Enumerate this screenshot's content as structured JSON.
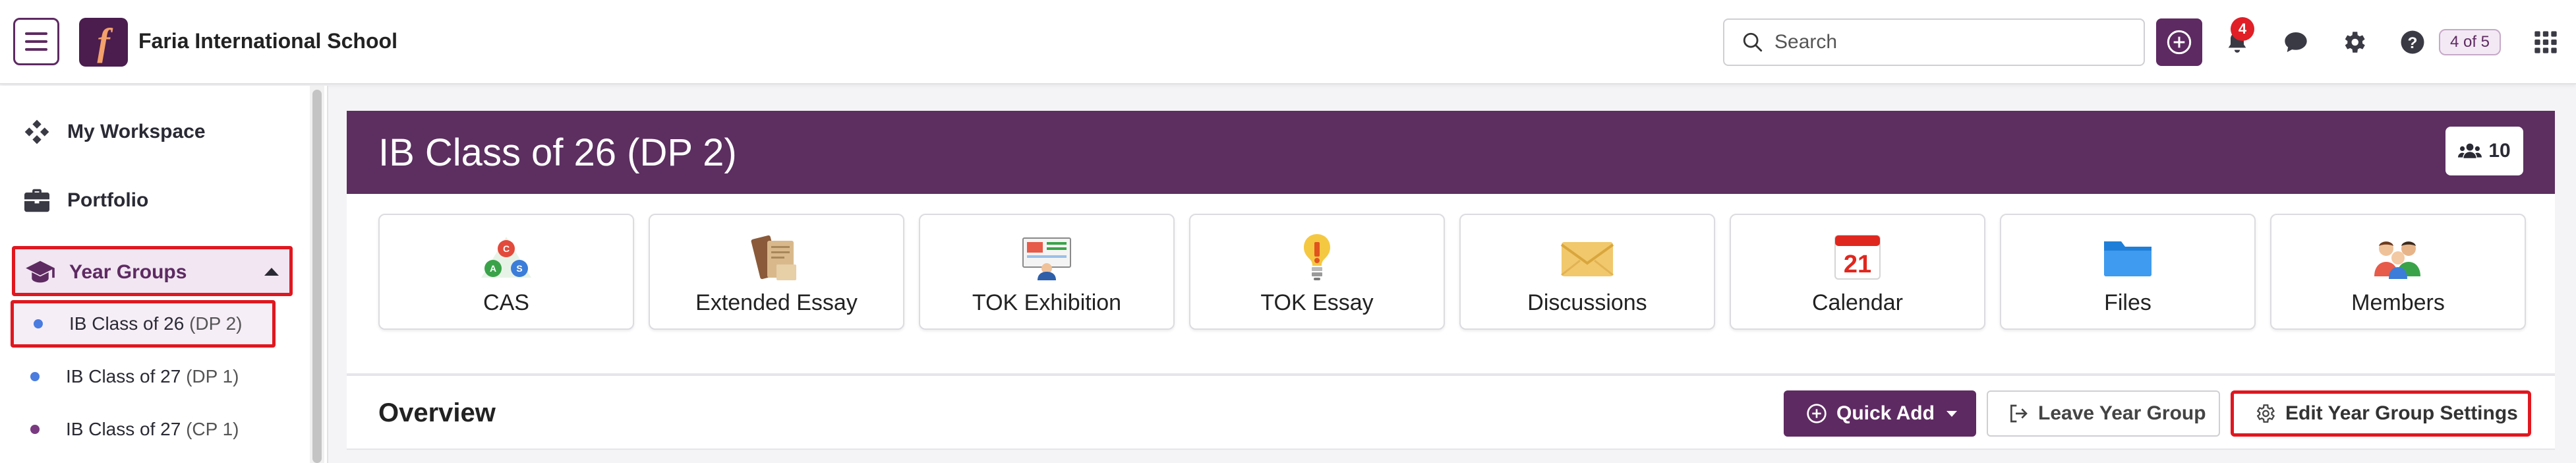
{
  "header": {
    "logo_letter": "f",
    "school_name": "Faria International School",
    "search_placeholder": "Search",
    "notification_count": "4",
    "page_counter": "4 of 5"
  },
  "sidebar": {
    "items": [
      {
        "label": "My Workspace",
        "icon": "workspace-icon"
      },
      {
        "label": "Portfolio",
        "icon": "briefcase-icon"
      }
    ],
    "year_groups": {
      "label": "Year Groups",
      "icon": "graduation-cap-icon",
      "expanded": true,
      "children": [
        {
          "name": "IB Class of 26",
          "code": "(DP 2)",
          "dot_color": "#4a7ce0",
          "active": true
        },
        {
          "name": "IB Class of 27",
          "code": "(DP 1)",
          "dot_color": "#4a7ce0",
          "active": false
        },
        {
          "name": "IB Class of 27",
          "code": "(CP 1)",
          "dot_color": "#7a3a80",
          "active": false
        }
      ]
    }
  },
  "main": {
    "title": "IB Class of 26 (DP 2)",
    "member_count": "10",
    "tiles": [
      {
        "label": "CAS",
        "icon": "cas-triangle-icon"
      },
      {
        "label": "Extended Essay",
        "icon": "books-icon"
      },
      {
        "label": "TOK Exhibition",
        "icon": "presentation-board-icon"
      },
      {
        "label": "TOK Essay",
        "icon": "lightbulb-icon"
      },
      {
        "label": "Discussions",
        "icon": "envelope-icon"
      },
      {
        "label": "Calendar",
        "icon": "calendar-icon",
        "calendar_day": "21"
      },
      {
        "label": "Files",
        "icon": "folder-icon"
      },
      {
        "label": "Members",
        "icon": "people-icon"
      }
    ],
    "overview": {
      "title": "Overview",
      "quick_add": "Quick Add",
      "leave": "Leave Year Group",
      "edit": "Edit Year Group Settings"
    }
  },
  "colors": {
    "brand_purple": "#5e2a62",
    "banner": "#5c2f60",
    "highlight_red": "#e0171f",
    "badge_red": "#e01f27"
  }
}
